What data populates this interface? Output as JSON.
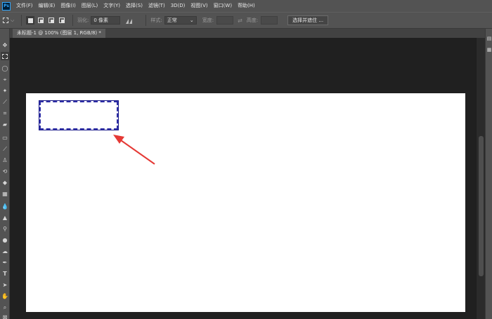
{
  "app": {
    "logo": "Ps"
  },
  "menu": [
    "文件(F)",
    "编辑(E)",
    "图像(I)",
    "图层(L)",
    "文字(Y)",
    "选择(S)",
    "滤镜(T)",
    "3D(D)",
    "视图(V)",
    "窗口(W)",
    "帮助(H)"
  ],
  "options": {
    "tool_icon": "rectangular-marquee-icon",
    "feather_label": "羽化:",
    "feather_value": "0 像素",
    "style_label": "样式:",
    "style_value": "正常",
    "width_label": "宽度:",
    "height_label": "高度:",
    "select_and_mask": "选择并遮住 ..."
  },
  "document": {
    "tab_title": "未标题-1 @ 100% (图层 1, RGB/8) *",
    "canvas_color": "#ffffff",
    "selection_color": "#2f2fa6",
    "annotation_arrow_color": "#e53935"
  },
  "toolbar": {
    "tools": [
      "move-icon",
      "rectangular-marquee-icon",
      "lasso-icon",
      "quick-selection-icon",
      "magic-wand-icon",
      "crop-icon",
      "eyedropper-icon",
      "ruler-icon",
      "spot-healing-icon",
      "brush-icon",
      "clone-stamp-icon",
      "history-brush-icon",
      "eraser-icon",
      "gradient-icon",
      "blur-icon",
      "sharpen-icon",
      "dodge-icon",
      "burn-icon",
      "sponge-icon",
      "pen-icon",
      "type-icon",
      "path-selection-icon",
      "hand-icon",
      "zoom-icon",
      "frame-icon"
    ]
  },
  "right_strip": {
    "icons": [
      "panel-icon",
      "panel-icon"
    ]
  }
}
